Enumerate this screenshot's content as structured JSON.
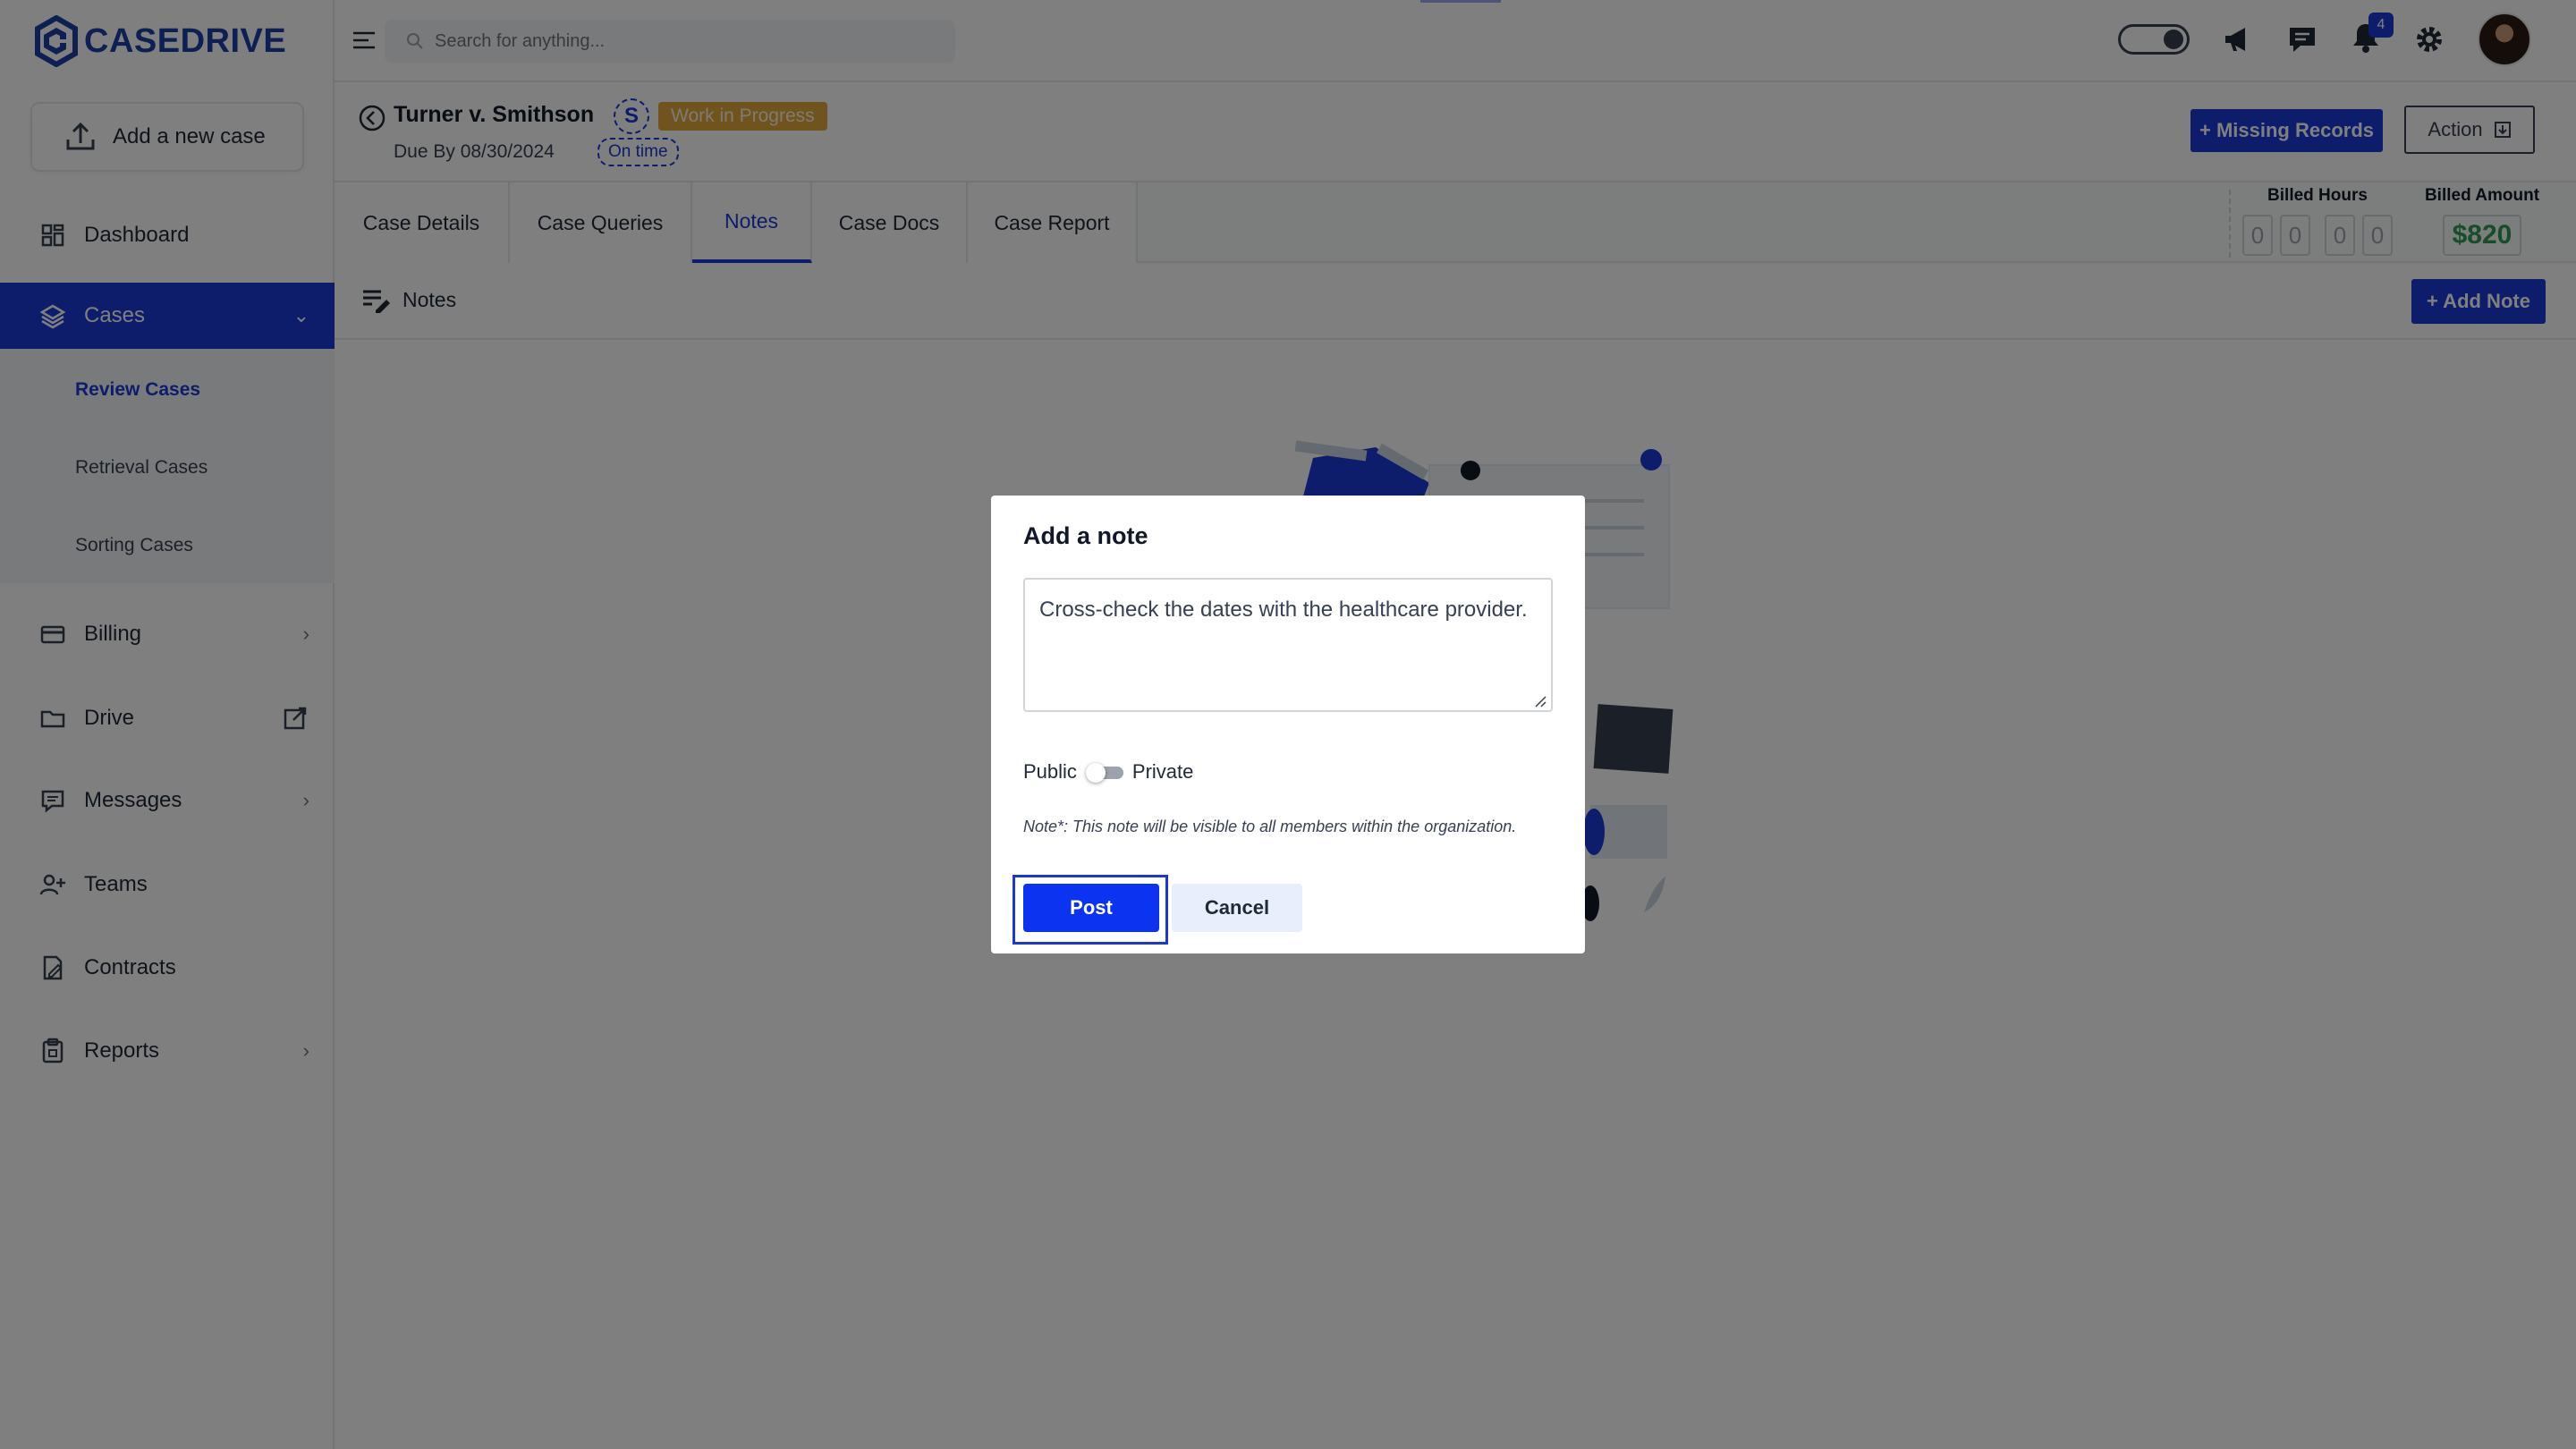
{
  "app": {
    "logo_text": "CASEDRIVE"
  },
  "sidebar": {
    "add_case_label": "Add a new case",
    "items": [
      {
        "label": "Dashboard",
        "icon": "dashboard-icon"
      },
      {
        "label": "Cases",
        "icon": "layers-icon",
        "active": true
      },
      {
        "label": "Billing",
        "icon": "credit-card-icon"
      },
      {
        "label": "Drive",
        "icon": "folder-icon"
      },
      {
        "label": "Messages",
        "icon": "message-icon"
      },
      {
        "label": "Teams",
        "icon": "users-icon"
      },
      {
        "label": "Contracts",
        "icon": "contract-icon"
      },
      {
        "label": "Reports",
        "icon": "clipboard-icon"
      }
    ],
    "cases_sub": [
      {
        "label": "Review Cases",
        "active": true
      },
      {
        "label": "Retrieval Cases"
      },
      {
        "label": "Sorting Cases"
      }
    ]
  },
  "topbar": {
    "search_placeholder": "Search for anything...",
    "notification_count": "4"
  },
  "case": {
    "title": "Turner v. Smithson",
    "initial": "S",
    "status": "Work in Progress",
    "due": "Due By 08/30/2024",
    "timeliness": "On time",
    "missing_records_label": "+ Missing Records",
    "action_label": "Action"
  },
  "tabs": [
    {
      "label": "Case Details"
    },
    {
      "label": "Case Queries"
    },
    {
      "label": "Notes",
      "active": true
    },
    {
      "label": "Case Docs"
    },
    {
      "label": "Case Report"
    }
  ],
  "billing": {
    "hours_label": "Billed Hours",
    "hours_digits": [
      "0",
      "0",
      "0",
      "0"
    ],
    "amount_label": "Billed Amount",
    "amount": "$820"
  },
  "notes": {
    "section_title": "Notes",
    "add_note_label": "+ Add Note"
  },
  "modal": {
    "title": "Add a note",
    "note_value": "Cross-check the dates with the healthcare provider.",
    "public_label": "Public",
    "private_label": "Private",
    "info_text": "Note*: This note will be visible to all members within the organization.",
    "post_label": "Post",
    "cancel_label": "Cancel"
  },
  "colors": {
    "accent": "#1a38d6",
    "status": "#e0a63b",
    "amount": "#2e9b54"
  }
}
